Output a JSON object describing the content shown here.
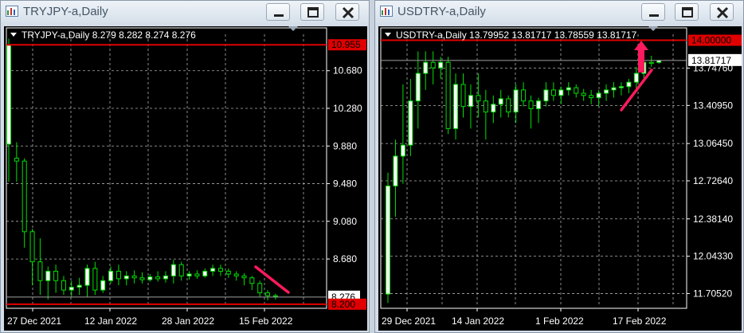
{
  "colors": {
    "bg": "#000000",
    "grid": "#b0b0b0",
    "bull": "#ffffff",
    "bear": "#000000",
    "wick": "#00e000",
    "line": "#e00000",
    "arrow": "#ff1a5e",
    "text": "#ffffff"
  },
  "windows": [
    {
      "title": "TRYJPY-a,Daily",
      "header": {
        "symbol": "TRYJPY-a,Daily",
        "ohlc": "8.279 8.282 8.274 8.276"
      },
      "bid_label": "8.276",
      "ytick_labels": [
        "10.680",
        "10.280",
        "9.880",
        "9.480",
        "9.080",
        "8.680"
      ],
      "xtick_labels": [
        "27 Dec 2021",
        "12 Jan 2022",
        "28 Jan 2022",
        "15 Feb 2022"
      ],
      "hlines": [
        {
          "label": "10.955"
        },
        {
          "label": "8.200"
        }
      ],
      "chart_data": {
        "type": "candlestick",
        "ylim": [
          8.19,
          11.05
        ],
        "hlines": [
          10.955,
          8.2
        ],
        "bid": 8.276,
        "candles": [
          {
            "o": 9.9,
            "h": 11.02,
            "l": 9.5,
            "c": 10.95
          },
          {
            "o": 9.75,
            "h": 9.92,
            "l": 9.5,
            "c": 9.72
          },
          {
            "o": 9.72,
            "h": 9.75,
            "l": 8.8,
            "c": 8.97
          },
          {
            "o": 8.97,
            "h": 9.0,
            "l": 8.4,
            "c": 8.65
          },
          {
            "o": 8.65,
            "h": 8.9,
            "l": 8.3,
            "c": 8.45
          },
          {
            "o": 8.45,
            "h": 8.6,
            "l": 8.25,
            "c": 8.55
          },
          {
            "o": 8.55,
            "h": 8.62,
            "l": 8.32,
            "c": 8.45
          },
          {
            "o": 8.45,
            "h": 8.5,
            "l": 8.3,
            "c": 8.35
          },
          {
            "o": 8.35,
            "h": 8.45,
            "l": 8.28,
            "c": 8.38
          },
          {
            "o": 8.38,
            "h": 8.48,
            "l": 8.3,
            "c": 8.4
          },
          {
            "o": 8.4,
            "h": 8.62,
            "l": 8.28,
            "c": 8.58
          },
          {
            "o": 8.58,
            "h": 8.65,
            "l": 8.3,
            "c": 8.35
          },
          {
            "o": 8.35,
            "h": 8.5,
            "l": 8.32,
            "c": 8.45
          },
          {
            "o": 8.45,
            "h": 8.6,
            "l": 8.42,
            "c": 8.55
          },
          {
            "o": 8.55,
            "h": 8.62,
            "l": 8.4,
            "c": 8.47
          },
          {
            "o": 8.47,
            "h": 8.55,
            "l": 8.4,
            "c": 8.5
          },
          {
            "o": 8.5,
            "h": 8.56,
            "l": 8.42,
            "c": 8.48
          },
          {
            "o": 8.48,
            "h": 8.54,
            "l": 8.42,
            "c": 8.46
          },
          {
            "o": 8.46,
            "h": 8.52,
            "l": 8.44,
            "c": 8.49
          },
          {
            "o": 8.49,
            "h": 8.55,
            "l": 8.44,
            "c": 8.47
          },
          {
            "o": 8.47,
            "h": 8.55,
            "l": 8.43,
            "c": 8.5
          },
          {
            "o": 8.5,
            "h": 8.67,
            "l": 8.42,
            "c": 8.62
          },
          {
            "o": 8.62,
            "h": 8.65,
            "l": 8.45,
            "c": 8.5
          },
          {
            "o": 8.5,
            "h": 8.55,
            "l": 8.46,
            "c": 8.52
          },
          {
            "o": 8.52,
            "h": 8.56,
            "l": 8.47,
            "c": 8.5
          },
          {
            "o": 8.5,
            "h": 8.58,
            "l": 8.48,
            "c": 8.55
          },
          {
            "o": 8.55,
            "h": 8.62,
            "l": 8.5,
            "c": 8.58
          },
          {
            "o": 8.58,
            "h": 8.62,
            "l": 8.5,
            "c": 8.55
          },
          {
            "o": 8.55,
            "h": 8.58,
            "l": 8.48,
            "c": 8.52
          },
          {
            "o": 8.52,
            "h": 8.55,
            "l": 8.45,
            "c": 8.5
          },
          {
            "o": 8.5,
            "h": 8.53,
            "l": 8.4,
            "c": 8.48
          },
          {
            "o": 8.48,
            "h": 8.5,
            "l": 8.35,
            "c": 8.42
          },
          {
            "o": 8.42,
            "h": 8.45,
            "l": 8.28,
            "c": 8.32
          },
          {
            "o": 8.32,
            "h": 8.35,
            "l": 8.24,
            "c": 8.29
          },
          {
            "o": 8.29,
            "h": 8.31,
            "l": 8.25,
            "c": 8.28
          }
        ]
      }
    },
    {
      "title": "USDTRY-a,Daily",
      "header": {
        "symbol": "USDTRY-a,Daily",
        "ohlc": "13.79952 13.81717 13.78559 13.81717"
      },
      "bid_label": "13.81717",
      "ytick_labels": [
        "13.74760",
        "13.40950",
        "13.06450",
        "12.72640",
        "12.38140",
        "12.04330",
        "11.70520"
      ],
      "xtick_labels": [
        "29 Dec 2021",
        "14 Jan 2022",
        "1 Feb 2022",
        "17 Feb 2022"
      ],
      "hlines": [
        {
          "label": "14.00000"
        }
      ],
      "chart_data": {
        "type": "candlestick",
        "ylim": [
          11.6,
          14.04
        ],
        "hlines": [
          14.0
        ],
        "bid": 13.81717,
        "candles": [
          {
            "o": 11.7,
            "h": 12.8,
            "l": 11.62,
            "c": 12.68
          },
          {
            "o": 12.68,
            "h": 13.1,
            "l": 12.4,
            "c": 12.95
          },
          {
            "o": 12.95,
            "h": 13.6,
            "l": 12.7,
            "c": 13.05
          },
          {
            "o": 13.05,
            "h": 13.65,
            "l": 12.95,
            "c": 13.45
          },
          {
            "o": 13.45,
            "h": 13.9,
            "l": 13.2,
            "c": 13.7
          },
          {
            "o": 13.7,
            "h": 13.9,
            "l": 13.55,
            "c": 13.8
          },
          {
            "o": 13.8,
            "h": 13.9,
            "l": 13.6,
            "c": 13.75
          },
          {
            "o": 13.75,
            "h": 13.85,
            "l": 13.65,
            "c": 13.8
          },
          {
            "o": 13.8,
            "h": 13.85,
            "l": 13.15,
            "c": 13.2
          },
          {
            "o": 13.2,
            "h": 13.7,
            "l": 13.1,
            "c": 13.6
          },
          {
            "o": 13.6,
            "h": 13.7,
            "l": 13.3,
            "c": 13.4
          },
          {
            "o": 13.4,
            "h": 13.6,
            "l": 13.2,
            "c": 13.5
          },
          {
            "o": 13.5,
            "h": 13.7,
            "l": 13.3,
            "c": 13.45
          },
          {
            "o": 13.45,
            "h": 13.55,
            "l": 13.1,
            "c": 13.35
          },
          {
            "o": 13.35,
            "h": 13.5,
            "l": 13.25,
            "c": 13.42
          },
          {
            "o": 13.42,
            "h": 13.55,
            "l": 13.3,
            "c": 13.47
          },
          {
            "o": 13.47,
            "h": 13.5,
            "l": 13.3,
            "c": 13.35
          },
          {
            "o": 13.35,
            "h": 13.6,
            "l": 13.25,
            "c": 13.55
          },
          {
            "o": 13.55,
            "h": 13.62,
            "l": 13.4,
            "c": 13.45
          },
          {
            "o": 13.45,
            "h": 13.5,
            "l": 13.2,
            "c": 13.38
          },
          {
            "o": 13.38,
            "h": 13.48,
            "l": 13.25,
            "c": 13.45
          },
          {
            "o": 13.45,
            "h": 13.62,
            "l": 13.4,
            "c": 13.55
          },
          {
            "o": 13.55,
            "h": 13.62,
            "l": 13.45,
            "c": 13.5
          },
          {
            "o": 13.5,
            "h": 13.58,
            "l": 13.42,
            "c": 13.55
          },
          {
            "o": 13.55,
            "h": 13.62,
            "l": 13.5,
            "c": 13.57
          },
          {
            "o": 13.57,
            "h": 13.6,
            "l": 13.48,
            "c": 13.52
          },
          {
            "o": 13.52,
            "h": 13.56,
            "l": 13.45,
            "c": 13.5
          },
          {
            "o": 13.5,
            "h": 13.55,
            "l": 13.42,
            "c": 13.48
          },
          {
            "o": 13.48,
            "h": 13.55,
            "l": 13.4,
            "c": 13.52
          },
          {
            "o": 13.52,
            "h": 13.6,
            "l": 13.45,
            "c": 13.55
          },
          {
            "o": 13.55,
            "h": 13.62,
            "l": 13.48,
            "c": 13.57
          },
          {
            "o": 13.57,
            "h": 13.62,
            "l": 13.5,
            "c": 13.58
          },
          {
            "o": 13.58,
            "h": 13.65,
            "l": 13.52,
            "c": 13.62
          },
          {
            "o": 13.62,
            "h": 13.76,
            "l": 13.55,
            "c": 13.7
          },
          {
            "o": 13.7,
            "h": 13.85,
            "l": 13.65,
            "c": 13.8
          },
          {
            "o": 13.8,
            "h": 13.86,
            "l": 13.76,
            "c": 13.79
          },
          {
            "o": 13.79952,
            "h": 13.82,
            "l": 13.78559,
            "c": 13.81717
          }
        ]
      }
    }
  ]
}
